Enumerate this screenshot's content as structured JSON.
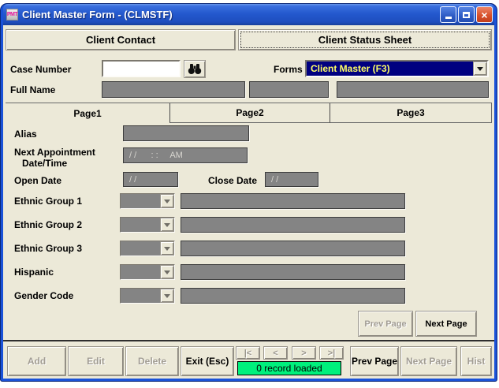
{
  "window": {
    "title": "Client Master Form - (CLMSTF)",
    "icon_label": "PMT"
  },
  "top_tabs": {
    "client_contact": "Client Contact",
    "client_status_sheet": "Client Status Sheet"
  },
  "lookup": {
    "case_number_label": "Case Number",
    "case_number_value": "",
    "forms_label": "Forms",
    "forms_selected": "Client Master (F3)"
  },
  "full_name": {
    "label": "Full Name",
    "values": [
      "",
      "",
      ""
    ]
  },
  "page_tabs": {
    "selected": "Page1",
    "tabs": [
      "Page1",
      "Page2",
      "Page3"
    ]
  },
  "fields": {
    "alias": {
      "label": "Alias",
      "value": ""
    },
    "next_appointment": {
      "label_line1": "Next Appointment",
      "label_line2": "Date/Time",
      "value": "/ /      : :     AM"
    },
    "open_date": {
      "label": "Open Date",
      "value": "/ /"
    },
    "close_date": {
      "label": "Close Date",
      "value": "/ /"
    },
    "combo_rows": [
      {
        "label": "Ethnic Group 1",
        "code": "",
        "description": ""
      },
      {
        "label": "Ethnic Group 2",
        "code": "",
        "description": ""
      },
      {
        "label": "Ethnic Group 3",
        "code": "",
        "description": ""
      },
      {
        "label": "Hispanic",
        "code": "",
        "description": ""
      },
      {
        "label": "Gender Code",
        "code": "",
        "description": ""
      }
    ]
  },
  "page_nav": {
    "prev_label": "Prev Page",
    "prev_enabled": false,
    "next_label": "Next Page",
    "next_enabled": true
  },
  "footer": {
    "add_label": "Add",
    "edit_label": "Edit",
    "delete_label": "Delete",
    "exit_label": "Exit (Esc)",
    "record_nav": [
      "|<",
      "<",
      ">",
      ">|"
    ],
    "status_text": "0 record loaded",
    "prev_label": "Prev Page",
    "next_label": "Next Page",
    "hist_label": "Hist",
    "enabled": {
      "add": false,
      "edit": false,
      "delete": false,
      "exit": true,
      "prev": true,
      "next": false,
      "hist": false
    }
  },
  "colors": {
    "background": "#ECE9D8",
    "title_bar_blue": "#2459CE",
    "forms_combo_bg": "#000080",
    "forms_combo_text": "#FFFF66",
    "field_gray": "#848484",
    "status_green": "#00F07C"
  },
  "icons": {
    "title_bar": [
      "minimize",
      "maximize",
      "close"
    ],
    "case_search": "binoculars",
    "combo": "chevron-down"
  }
}
